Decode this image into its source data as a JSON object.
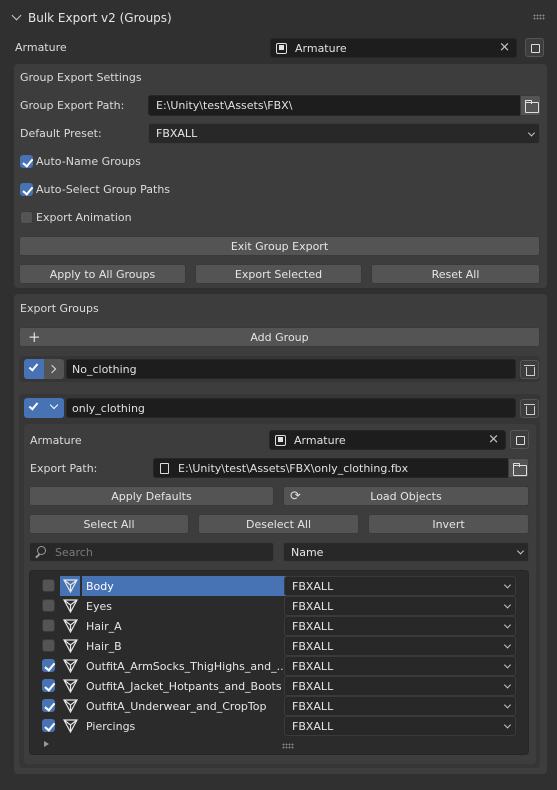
{
  "panel": {
    "title": "Bulk Export v2 (Groups)"
  },
  "armature": {
    "label": "Armature",
    "value": "Armature"
  },
  "settings": {
    "title": "Group Export Settings",
    "path_label": "Group Export Path:",
    "path_value": "E:\\Unity\\test\\Assets\\FBX\\",
    "preset_label": "Default Preset:",
    "preset_value": "FBXALL",
    "auto_name": {
      "label": "Auto-Name Groups",
      "checked": true
    },
    "auto_select": {
      "label": "Auto-Select Group Paths",
      "checked": true
    },
    "export_anim": {
      "label": "Export Animation",
      "checked": false
    },
    "exit_label": "Exit Group Export",
    "apply_all_label": "Apply to All Groups",
    "export_selected_label": "Export Selected",
    "reset_all_label": "Reset All"
  },
  "groups": {
    "title": "Export Groups",
    "add_label": "Add Group",
    "list": [
      {
        "name": "No_clothing",
        "checked": true,
        "expanded": false
      },
      {
        "name": "only_clothing",
        "checked": true,
        "expanded": true
      }
    ]
  },
  "group_detail": {
    "armature_label": "Armature",
    "armature_value": "Armature",
    "path_label": "Export Path:",
    "path_value": "E:\\Unity\\test\\Assets\\FBX\\only_clothing.fbx",
    "apply_defaults_label": "Apply Defaults",
    "load_objects_label": "Load Objects",
    "select_all_label": "Select All",
    "deselect_all_label": "Deselect All",
    "invert_label": "Invert",
    "search_placeholder": "Search",
    "sort_value": "Name",
    "objects": [
      {
        "name": "Body",
        "checked": false,
        "preset": "FBXALL",
        "active": true
      },
      {
        "name": "Eyes",
        "checked": false,
        "preset": "FBXALL",
        "active": false
      },
      {
        "name": "Hair_A",
        "checked": false,
        "preset": "FBXALL",
        "active": false
      },
      {
        "name": "Hair_B",
        "checked": false,
        "preset": "FBXALL",
        "active": false
      },
      {
        "name": "OutfitA_ArmSocks_ThigHighs_and_...",
        "checked": true,
        "preset": "FBXALL",
        "active": false
      },
      {
        "name": "OutfitA_Jacket_Hotpants_and_Boots",
        "checked": true,
        "preset": "FBXALL",
        "active": false
      },
      {
        "name": "OutfitA_Underwear_and_CropTop",
        "checked": true,
        "preset": "FBXALL",
        "active": false
      },
      {
        "name": "Piercings",
        "checked": true,
        "preset": "FBXALL",
        "active": false
      }
    ]
  },
  "icons": {
    "collapse": "chevron-down-icon",
    "drag": "drag-handle-icon",
    "object": "object-icon",
    "clear": "close-icon",
    "browse": "folder-icon",
    "delete": "trash-icon",
    "refresh": "refresh-icon",
    "search": "search-icon",
    "mesh": "mesh-icon",
    "add": "plus-icon"
  },
  "colors": {
    "accent": "#4772b3",
    "background": "#303030",
    "panel": "#3d3d3d"
  }
}
